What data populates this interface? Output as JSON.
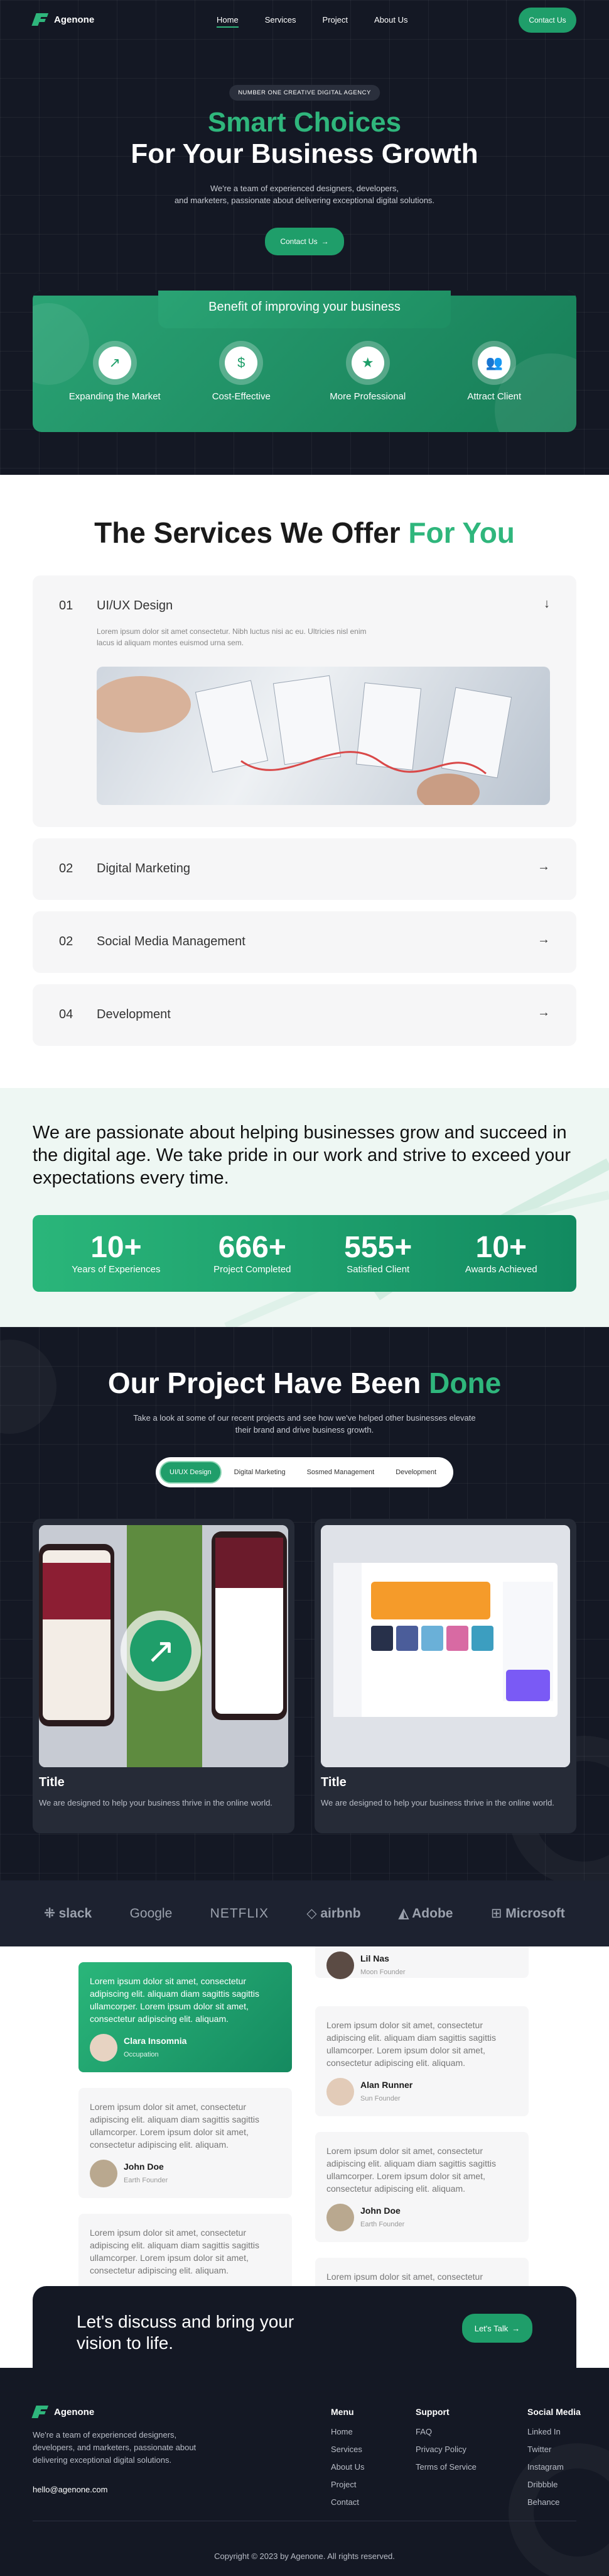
{
  "nav": {
    "brand": "Agenone",
    "links": [
      "Home",
      "Services",
      "Project",
      "About Us"
    ],
    "contact": "Contact Us"
  },
  "hero": {
    "badge": "NUMBER ONE CREATIVE DIGITAL AGENCY",
    "title_green": "Smart Choices",
    "title_white": "For Your Business Growth",
    "sub_line1": "We're a team of experienced designers, developers,",
    "sub_line2": "and marketers, passionate about delivering exceptional digital solutions.",
    "cta": "Contact Us"
  },
  "benefit": {
    "title": "Benefit of improving your business",
    "items": [
      {
        "label": "Expanding the Market",
        "icon": "arrow-up-right-icon"
      },
      {
        "label": "Cost-Effective",
        "icon": "money-icon"
      },
      {
        "label": "More Professional",
        "icon": "star-badge-icon"
      },
      {
        "label": "Attract Client",
        "icon": "users-icon"
      }
    ]
  },
  "services": {
    "title_dark": "The Services We Offer",
    "title_green": "For You",
    "items": [
      {
        "num": "01",
        "title": "UI/UX Design",
        "desc_line1": "Lorem ipsum dolor sit amet consectetur. Nibh luctus nisi ac eu. Ultricies nisl enim",
        "desc_line2": "lacus id aliquam montes euismod urna sem."
      },
      {
        "num": "02",
        "title": "Digital Marketing"
      },
      {
        "num": "02",
        "title": "Social Media Management"
      },
      {
        "num": "04",
        "title": "Development"
      }
    ]
  },
  "passion": {
    "text": "We are passionate about helping businesses grow and succeed in the digital age. We take pride in our work and strive to exceed your expectations every time.",
    "stats": [
      {
        "value": "10+",
        "label": "Years of Experiences"
      },
      {
        "value": "666+",
        "label": "Project Completed"
      },
      {
        "value": "555+",
        "label": "Satisfied Client"
      },
      {
        "value": "10+",
        "label": "Awards Achieved"
      }
    ]
  },
  "projects": {
    "title_white": "Our Project Have Been",
    "title_green": "Done",
    "sub_line1": "Take a look at some of our recent projects and see how we've helped other businesses elevate",
    "sub_line2": "their brand and drive business growth.",
    "tabs": [
      "UI/UX Design",
      "Digital Marketing",
      "Sosmed Management",
      "Development"
    ],
    "cards": [
      {
        "title": "Title",
        "desc": "We are designed to help your business thrive in the online world."
      },
      {
        "title": "Title",
        "desc": "We are designed to help your business thrive in the online world."
      }
    ]
  },
  "logos": [
    "slack",
    "Google",
    "NETFLIX",
    "airbnb",
    "Adobe",
    "Microsoft"
  ],
  "testimonials": {
    "quote": "Lorem ipsum dolor sit amet, consectetur adipiscing elit. aliquam diam sagittis sagittis ullamcorper. Lorem ipsum dolor sit amet, consectetur adipiscing elit. aliquam.",
    "people": [
      {
        "name": "Clara Insomnia",
        "role": "Occupation"
      },
      {
        "name": "John Doe",
        "role": "Earth Founder"
      },
      {
        "name": "Lil Nas",
        "role": "Moon Founder"
      },
      {
        "name": "Alan Runner",
        "role": "Sun Founder"
      },
      {
        "name": "John Doe",
        "role": "Earth Founder"
      }
    ]
  },
  "cta": {
    "text": "Let's discuss and bring your vision to life.",
    "button": "Let's Talk"
  },
  "footer": {
    "brand": "Agenone",
    "about": "We're a team of experienced designers, developers, and marketers, passionate about delivering exceptional digital solutions.",
    "email": "hello@agenone.com",
    "menu": {
      "title": "Menu",
      "items": [
        "Home",
        "Services",
        "About Us",
        "Project",
        "Contact"
      ]
    },
    "support": {
      "title": "Support",
      "items": [
        "FAQ",
        "Privacy Policy",
        "Terms of Service"
      ]
    },
    "social": {
      "title": "Social Media",
      "items": [
        "Linked In",
        "Twitter",
        "Instagram",
        "Dribbble",
        "Behance"
      ]
    },
    "copyright": "Copyright © 2023 by Agenone. All rights reserved."
  },
  "colors": {
    "accent": "#1f9e6a",
    "dark": "#141824"
  }
}
